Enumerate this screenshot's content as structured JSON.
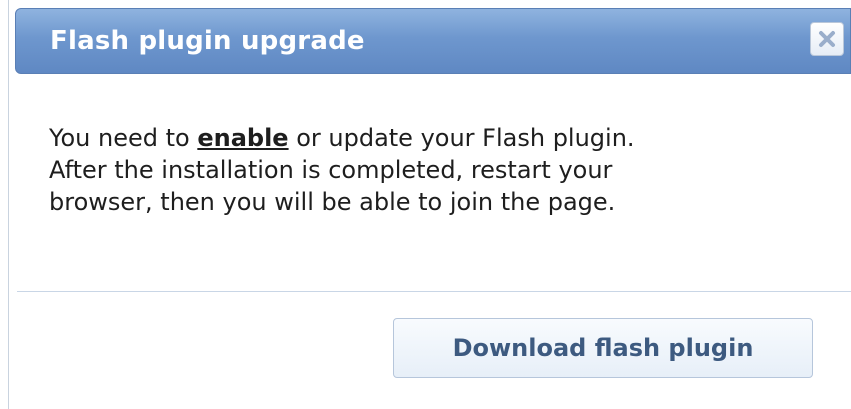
{
  "dialog": {
    "title": "Flash plugin upgrade",
    "close_icon": "close-icon",
    "message": {
      "line1_before": "You need to ",
      "enable_link": "enable",
      "line1_after": " or update your Flash plugin.",
      "line2": "After the installation is completed, restart your",
      "line3": "browser, then you will be able to join the page."
    },
    "download_button_label": "Download flash plugin"
  },
  "colors": {
    "titlebar": "#6e97ce",
    "button_text": "#3d5a80",
    "body_text": "#1e1e1e"
  }
}
